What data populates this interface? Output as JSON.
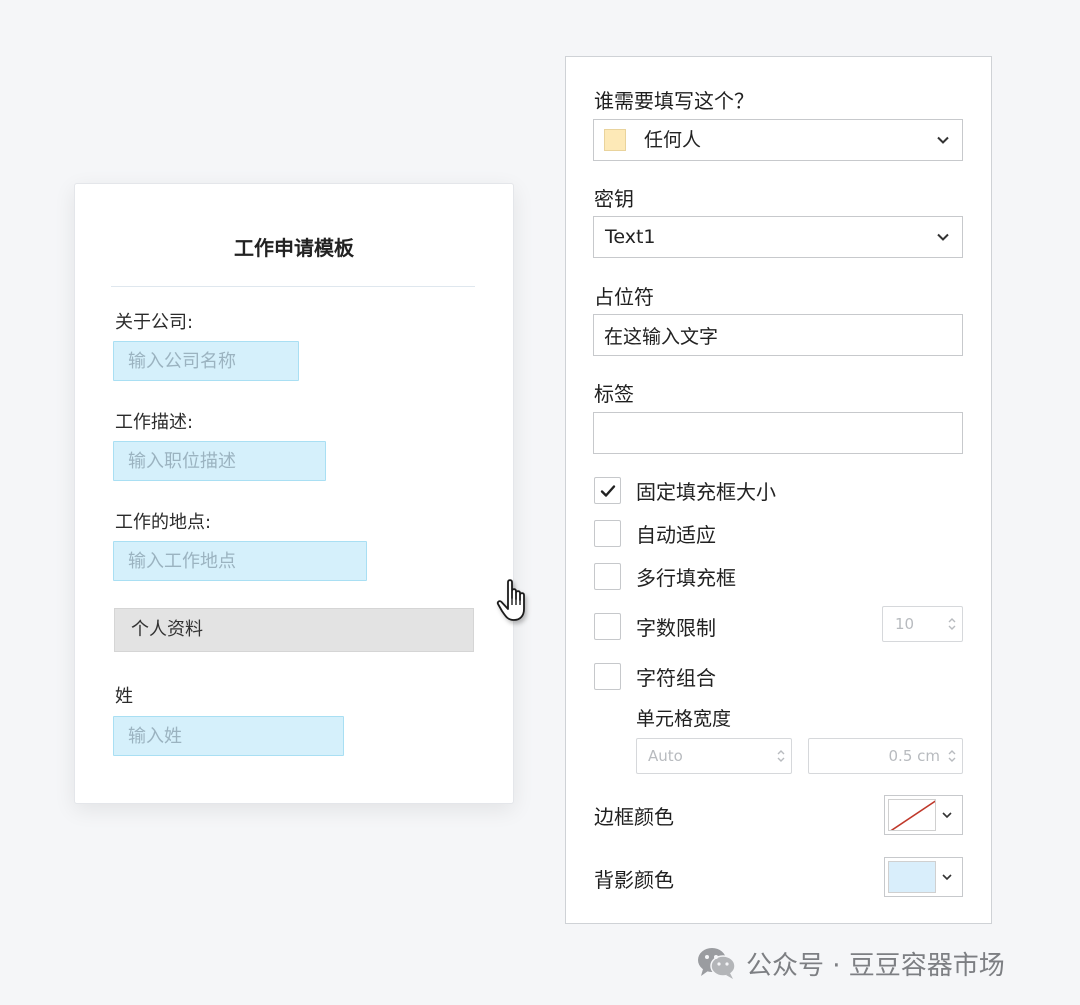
{
  "form": {
    "title": "工作申请模板",
    "fields": [
      {
        "label": "关于公司:",
        "placeholder": "输入公司名称"
      },
      {
        "label": "工作描述:",
        "placeholder": "输入职位描述"
      },
      {
        "label": "工作的地点:",
        "placeholder": "输入工作地点"
      }
    ],
    "section": "个人资料",
    "last_name": {
      "label": "姓",
      "placeholder": "输入姓"
    }
  },
  "panel": {
    "who_label": "谁需要填写这个？",
    "who_value": "任何人",
    "who_color": "#fde9b7",
    "key_label": "密钥",
    "key_value": "Text1",
    "placeholder_label": "占位符",
    "placeholder_value": "在这输入文字",
    "tag_label": "标签",
    "tag_value": "",
    "checks": [
      {
        "label": "固定填充框大小",
        "checked": true
      },
      {
        "label": "自动适应",
        "checked": false
      },
      {
        "label": "多行填充框",
        "checked": false
      },
      {
        "label": "字数限制",
        "checked": false
      },
      {
        "label": "字符组合",
        "checked": false
      }
    ],
    "char_limit": "10",
    "cell_width_label": "单元格宽度",
    "cell_width_mode": "Auto",
    "cell_width_value": "0.5 cm",
    "border_color_label": "边框颜色",
    "bg_color_label": "背影颜色",
    "bg_color": "#d9eefb"
  },
  "icons": {
    "cursor": "hand-pointer-icon",
    "chevron": "chevron-down-icon",
    "check": "checkmark-icon",
    "watermark": "wechat-icon"
  },
  "watermark": {
    "text": "公众号 · 豆豆容器市场"
  }
}
